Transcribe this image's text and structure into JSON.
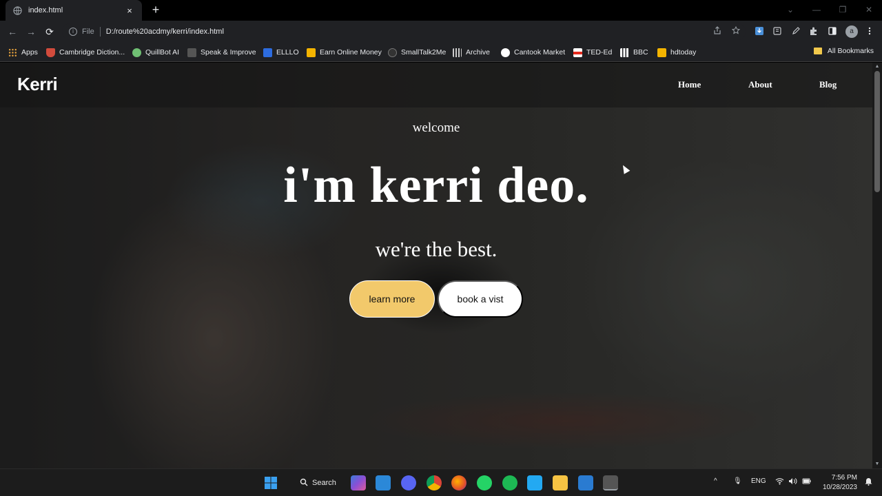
{
  "browser": {
    "tab": {
      "title": "index.html",
      "close": "×"
    },
    "new_tab": "+",
    "window_controls": {
      "menu": "⌄",
      "minimize": "—",
      "restore": "❐",
      "close": "✕"
    },
    "nav": {
      "back": "←",
      "forward": "→",
      "reload": "⟳"
    },
    "omnibox": {
      "info": "i",
      "scheme": "File",
      "url": "D:/route%20acdmy/kerri/index.html"
    },
    "profile_initial": "a",
    "bookmarks": [
      {
        "label": "Apps",
        "color": "#e8a33d"
      },
      {
        "label": "Cambridge Diction...",
        "color": "#d24b3c"
      },
      {
        "label": "QuillBot AI",
        "color": "#6fbf73"
      },
      {
        "label": "Speak & Improve",
        "color": "#444444"
      },
      {
        "label": "ELLLO",
        "color": "#2d6cdf"
      },
      {
        "label": "Earn Online Money",
        "color": "#f4b400"
      },
      {
        "label": "SmallTalk2Me",
        "color": "#333333"
      },
      {
        "label": "Archive",
        "color": "#cccccc"
      },
      {
        "label": "Cantook Market",
        "color": "#ffffff"
      },
      {
        "label": "TED-Ed",
        "color": "#e62b1e"
      },
      {
        "label": "BBC",
        "color": "#ffffff"
      },
      {
        "label": "hdtoday",
        "color": "#f4b400"
      }
    ],
    "all_bookmarks": "All Bookmarks"
  },
  "site": {
    "logo": "Kerri",
    "nav": {
      "home": "Home",
      "about": "About",
      "blog": "Blog"
    },
    "hero": {
      "welcome": "welcome",
      "headline": "i'm kerri deo.",
      "tagline": "we're the best.",
      "primary_button": "learn more",
      "secondary_button": "book a vist"
    },
    "accent_color": "#f2c96b"
  },
  "taskbar": {
    "search_label": "Search",
    "language": "ENG",
    "time": "7:56 PM",
    "date": "10/28/2023"
  }
}
